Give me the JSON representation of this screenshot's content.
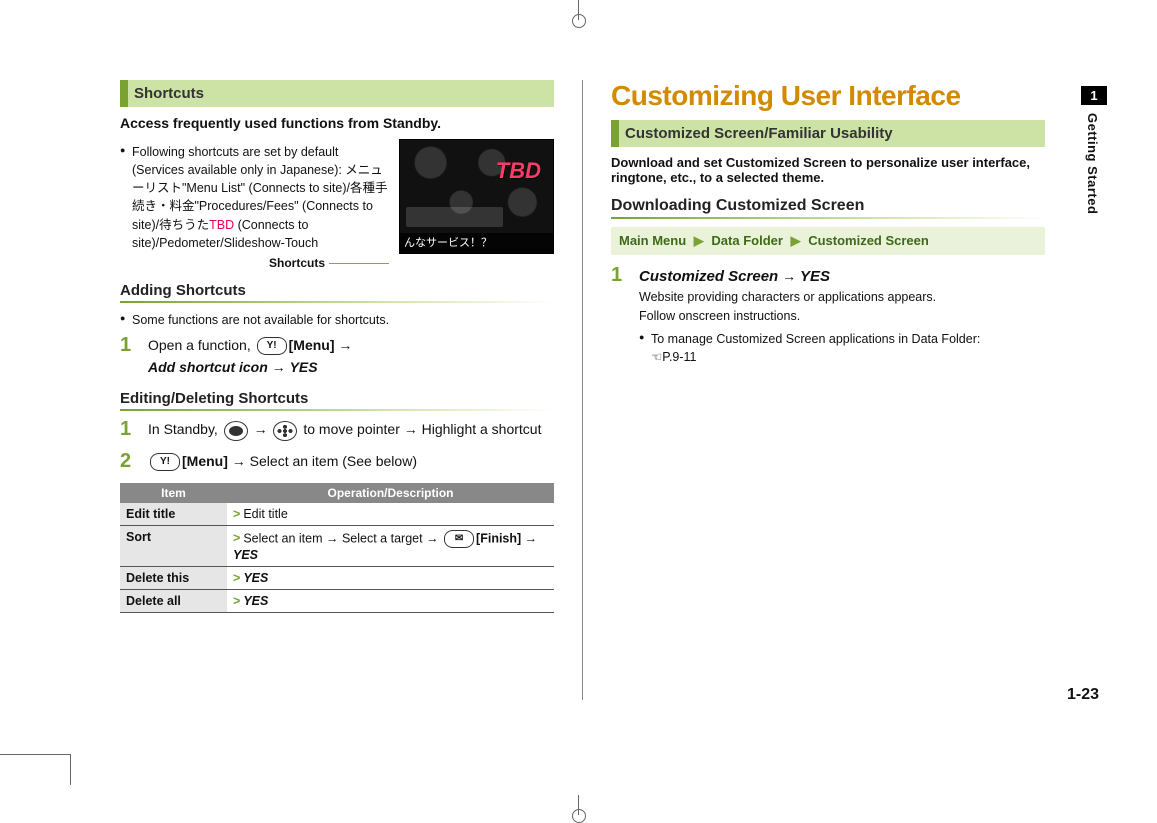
{
  "page_number": "1-23",
  "side_tab": {
    "chapter_num": "1",
    "chapter_title": "Getting Started"
  },
  "left": {
    "section_title": "Shortcuts",
    "intro": "Access frequently used functions from Standby.",
    "default_bullet": "Following shortcuts are set by default (Services available only in Japanese): メニューリスト\"Menu List\" (Connects to site)/各種手続き・料金\"Procedures/Fees\" (Connects to site)/待ちうたTBD (Connects to site)/Pedometer/Slideshow-Touch",
    "tbd_text": "TBD",
    "screenshot": {
      "tbd_overlay": "TBD",
      "bottom_text": "んなサービス！？"
    },
    "screenshot_caption": "Shortcuts",
    "sub1_title": "Adding Shortcuts",
    "sub1_note": "Some functions are not available for shortcuts.",
    "sub1_step1_pre": "Open a function, ",
    "sub1_step1_menu": "[Menu]",
    "sub1_step1_add": "Add shortcut icon",
    "sub1_step1_yes": "YES",
    "sub2_title": "Editing/Deleting Shortcuts",
    "sub2_step1_a": "In Standby, ",
    "sub2_step1_b": " to move pointer ",
    "sub2_step1_c": " Highlight a shortcut",
    "sub2_step2_menu": "[Menu]",
    "sub2_step2_rest": " Select an item (See below)",
    "table": {
      "head_item": "Item",
      "head_desc": "Operation/Description",
      "rows": [
        {
          "item": "Edit title",
          "desc": "Edit title"
        },
        {
          "item": "Sort",
          "desc_pre": "Select an item ",
          "desc_mid": " Select a target ",
          "finish": "[Finish]",
          "yes": "YES"
        },
        {
          "item": "Delete this",
          "yes": "YES"
        },
        {
          "item": "Delete all",
          "yes": "YES"
        }
      ]
    }
  },
  "right": {
    "main_title": "Customizing User Interface",
    "section_title": "Customized Screen/Familiar Usability",
    "intro": "Download and set Customized Screen to personalize user interface, ringtone, etc., to a selected theme.",
    "sub_title": "Downloading Customized Screen",
    "menu_path": {
      "a": "Main Menu",
      "b": "Data Folder",
      "c": "Customized Screen"
    },
    "step1_title_a": "Customized Screen",
    "step1_title_b": "YES",
    "step1_line1": "Website providing characters or applications appears.",
    "step1_line2": "Follow onscreen instructions.",
    "step1_bullet": "To manage Customized Screen applications in Data Folder:",
    "step1_ref": "P.9-11"
  }
}
